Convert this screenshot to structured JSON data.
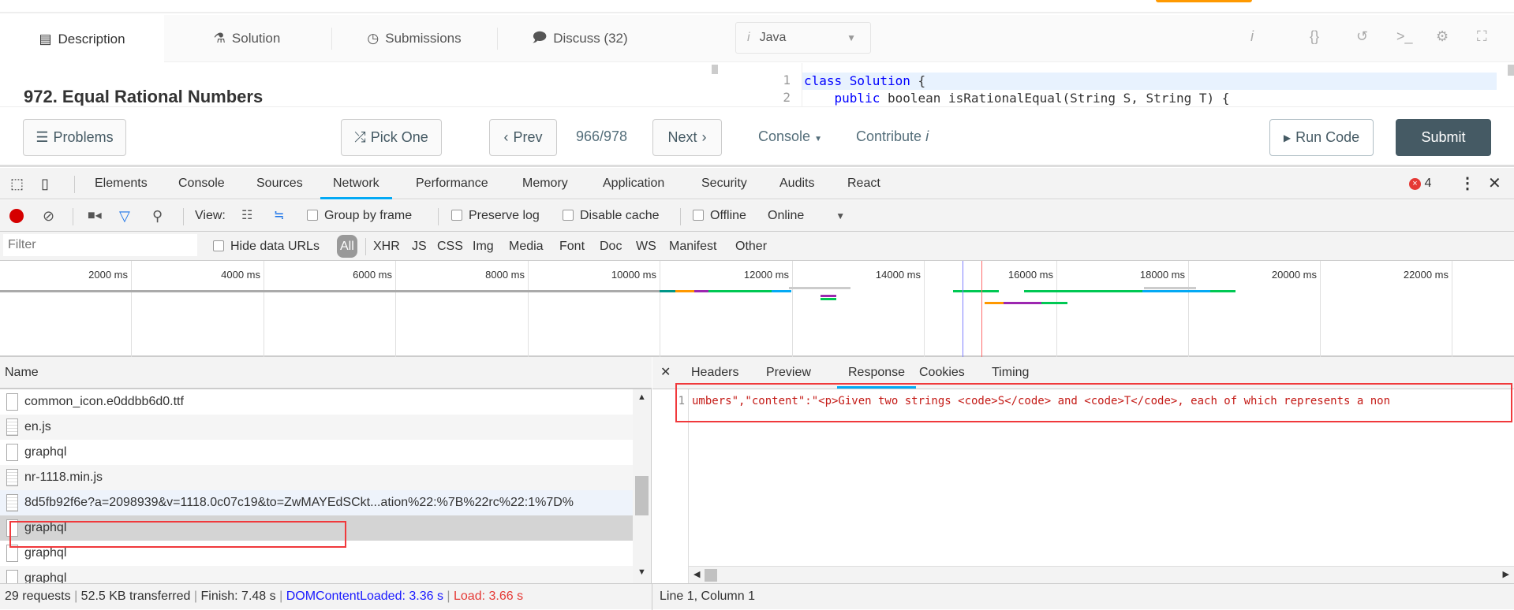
{
  "problem": {
    "tabs": [
      "Description",
      "Solution",
      "Submissions",
      "Discuss (32)"
    ],
    "title": "972. Equal Rational Numbers"
  },
  "editor": {
    "language": "Java",
    "lines": [
      {
        "num": "1",
        "code_kw": "class Solution",
        "code_rest": " {"
      },
      {
        "num": "2",
        "code_kw": "    public",
        "code_rest": " boolean isRationalEqual(String S, String T) {"
      }
    ]
  },
  "toolbar": {
    "problems": "Problems",
    "pick_one": "Pick One",
    "prev": "Prev",
    "page": "966/978",
    "next": "Next",
    "console": "Console",
    "contribute": "Contribute",
    "run_code": "Run Code",
    "submit": "Submit"
  },
  "devtools": {
    "tabs": [
      "Elements",
      "Console",
      "Sources",
      "Network",
      "Performance",
      "Memory",
      "Application",
      "Security",
      "Audits",
      "React"
    ],
    "error_count": "4",
    "view_label": "View:",
    "group_by_frame": "Group by frame",
    "preserve_log": "Preserve log",
    "disable_cache": "Disable cache",
    "offline": "Offline",
    "throttle": "Online",
    "filter_placeholder": "Filter",
    "hide_data_urls": "Hide data URLs",
    "types": [
      "All",
      "XHR",
      "JS",
      "CSS",
      "Img",
      "Media",
      "Font",
      "Doc",
      "WS",
      "Manifest",
      "Other"
    ],
    "ticks": [
      "2000 ms",
      "4000 ms",
      "6000 ms",
      "8000 ms",
      "10000 ms",
      "12000 ms",
      "14000 ms",
      "16000 ms",
      "18000 ms",
      "20000 ms",
      "22000 ms"
    ],
    "name_header": "Name",
    "requests": [
      {
        "name": "common_icon.e0ddbb6d0.ttf",
        "type": "doc"
      },
      {
        "name": "en.js",
        "type": "js"
      },
      {
        "name": "graphql",
        "type": "doc"
      },
      {
        "name": "nr-1118.min.js",
        "type": "js"
      },
      {
        "name": "8d5fb92f6e?a=2098939&v=1118.0c07c19&to=ZwMAYEdSCkt...ation%22:%7B%22rc%22:1%7D%",
        "type": "js"
      },
      {
        "name": "graphql",
        "type": "doc"
      },
      {
        "name": "graphql",
        "type": "doc"
      },
      {
        "name": "graphql",
        "type": "doc"
      }
    ],
    "detail_tabs": [
      "Headers",
      "Preview",
      "Response",
      "Cookies",
      "Timing"
    ],
    "response_line_num": "1",
    "response_text": "umbers\",\"content\":\"<p>Given two strings <code>S</code> and <code>T</code>, each of which represents a non",
    "status": {
      "requests": "29 requests",
      "transferred": "52.5 KB transferred",
      "finish": "Finish: 7.48 s",
      "dcl": "DOMContentLoaded: 3.36 s",
      "load": "Load: 3.66 s",
      "cursor": "Line 1, Column 1"
    }
  }
}
